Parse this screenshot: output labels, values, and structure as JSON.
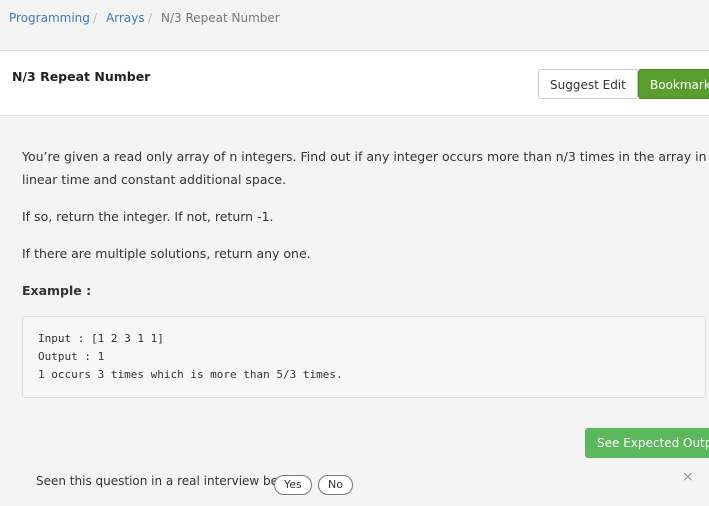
{
  "breadcrumb": {
    "items": [
      "Programming",
      "Arrays",
      "N/3 Repeat Number"
    ],
    "separator": "/"
  },
  "header": {
    "title": "N/3 Repeat Number",
    "suggest_edit": "Suggest Edit",
    "bookmark": "Bookmark"
  },
  "problem": {
    "paragraphs": [
      "You’re given a read only array of n integers. Find out if any integer occurs more than n/3 times in the array in linear time and constant additional space.",
      "If so, return the integer. If not, return -1.",
      "If there are multiple solutions, return any one."
    ],
    "example_label": "Example :",
    "code_lines": [
      "Input : [1 2 3 1 1]",
      "Output : 1",
      "1 occurs 3 times which is more than 5/3 times."
    ]
  },
  "actions": {
    "see_expected_output": "See Expected Output"
  },
  "feedback": {
    "question": "Seen this question in a real interview before",
    "yes": "Yes",
    "no": "No",
    "close": "×"
  },
  "colors": {
    "link": "#3a7bbf",
    "bookmark_bg": "#5a9e2e",
    "expected_bg": "#5cb85c"
  }
}
